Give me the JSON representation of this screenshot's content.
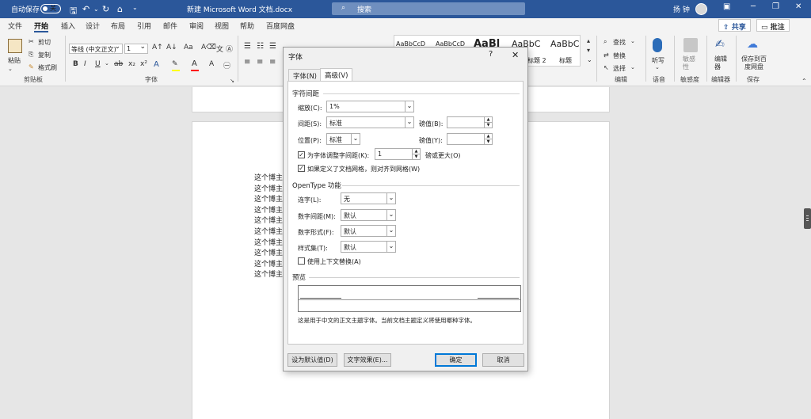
{
  "titlebar": {
    "autosave_label": "自动保存",
    "autosave_state": "关",
    "doc_title": "新建 Microsoft Word 文档.docx",
    "search_placeholder": "搜索",
    "user_name": "扬 钟"
  },
  "menu": {
    "items": [
      "文件",
      "开始",
      "插入",
      "设计",
      "布局",
      "引用",
      "邮件",
      "审阅",
      "视图",
      "帮助",
      "百度网盘"
    ],
    "share_label": "共享",
    "comment_label": "批注"
  },
  "ribbon": {
    "clipboard": {
      "paste": "粘贴",
      "cut": "剪切",
      "copy": "复制",
      "format_painter": "格式刷",
      "group": "剪贴板"
    },
    "font": {
      "font_name": "等线 (中文正文)",
      "font_size": "1",
      "group": "字体"
    },
    "styles": {
      "items": [
        "AaBbCcD",
        "AaBbCcD",
        "AaBl",
        "AaBbC",
        "AaBbC"
      ],
      "captions": [
        "",
        "",
        "",
        "标题 2",
        "标题"
      ]
    },
    "editing": {
      "find": "查找",
      "replace": "替换",
      "select": "选择",
      "group": "编辑"
    },
    "voice": {
      "dictate": "听写",
      "group": "语音"
    },
    "sensitivity": {
      "label": "敏感性",
      "group": "敏感度"
    },
    "editor": {
      "label": "编辑器",
      "group": "编辑器"
    },
    "save": {
      "label": "保存到百度网盘",
      "group": "保存"
    }
  },
  "document": {
    "line_text": "这个博主",
    "line_count": 10
  },
  "dialog": {
    "title": "字体",
    "help": "?",
    "tabs": [
      {
        "label": "字体(N)"
      },
      {
        "label": "高级(V)"
      }
    ],
    "spacing": {
      "section": "字符间距",
      "scale_label": "缩放(C):",
      "scale_value": "1%",
      "spacing_label": "间距(S):",
      "spacing_value": "标准",
      "spacing_pt_label": "磅值(B):",
      "position_label": "位置(P):",
      "position_value": "标准",
      "position_pt_label": "磅值(Y):",
      "kerning_label": "为字体调整字间距(K):",
      "kerning_value": "1",
      "kerning_suffix": "磅或更大(O)",
      "kerning_checked": true,
      "grid_label": "如果定义了文档网格，则对齐到网格(W)",
      "grid_checked": true
    },
    "opentype": {
      "section": "OpenType 功能",
      "ligatures_label": "连字(L):",
      "ligatures_value": "无",
      "num_spacing_label": "数字间距(M):",
      "num_spacing_value": "默认",
      "num_forms_label": "数字形式(F):",
      "num_forms_value": "默认",
      "stylistic_label": "样式集(T):",
      "stylistic_value": "默认",
      "contextual_label": "使用上下文替换(A)",
      "contextual_checked": false
    },
    "preview": {
      "section": "预览",
      "note": "这是用于中文的正文主题字体。当前文档主题定义将使用哪种字体。"
    },
    "buttons": {
      "set_default": "设为默认值(D)",
      "text_effects": "文字效果(E)...",
      "ok": "确定",
      "cancel": "取消"
    }
  },
  "colors": {
    "accent": "#2b579a",
    "highlight": "#ffff00",
    "font_color": "#ff0000",
    "default_button": "#0078d7"
  }
}
